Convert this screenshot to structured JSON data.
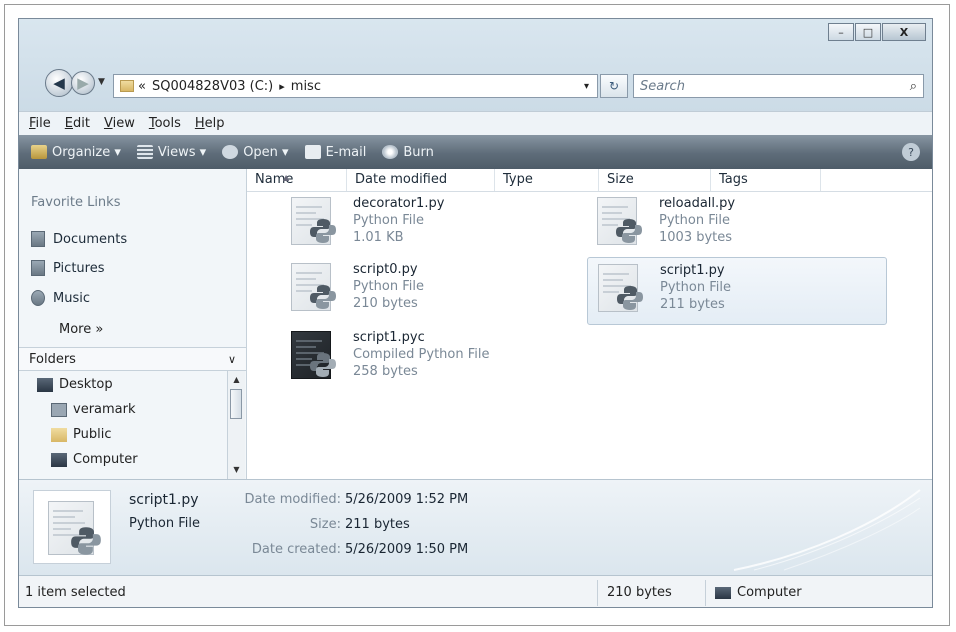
{
  "window": {
    "caption_buttons": {
      "minimize": "–",
      "maximize": "□",
      "close": "X"
    }
  },
  "address_bar": {
    "overflow_chevron": "«",
    "drive": "SQ004828V03 (C:)",
    "separator": "▸",
    "folder": "misc",
    "dropdown": "▾",
    "refresh_glyph": "↻"
  },
  "search": {
    "placeholder": "Search",
    "icon": "⌕"
  },
  "menu": {
    "file_hot": "F",
    "file_rest": "ile",
    "edit_hot": "E",
    "edit_rest": "dit",
    "view_hot": "V",
    "view_rest": "iew",
    "tools_hot": "T",
    "tools_rest": "ools",
    "help_hot": "H",
    "help_rest": "elp"
  },
  "toolbar": {
    "organize": "Organize ▾",
    "views": "Views ▾",
    "open": "Open ▾",
    "email": "E-mail",
    "burn": "Burn",
    "help": "?"
  },
  "nav": {
    "favorite_links_title": "Favorite Links",
    "links": [
      "Documents",
      "Pictures",
      "Music"
    ],
    "more": "More »",
    "folders_title": "Folders",
    "folders_chevron": "∨",
    "tree": [
      "Desktop",
      "veramark",
      "Public",
      "Computer"
    ]
  },
  "columns": {
    "name": "Name",
    "date_modified": "Date modified",
    "type": "Type",
    "size": "Size",
    "tags": "Tags"
  },
  "files": [
    {
      "name": "decorator1.py",
      "type": "Python File",
      "size": "1.01 KB"
    },
    {
      "name": "reloadall.py",
      "type": "Python File",
      "size": "1003 bytes"
    },
    {
      "name": "script0.py",
      "type": "Python File",
      "size": "210 bytes"
    },
    {
      "name": "script1.py",
      "type": "Python File",
      "size": "211 bytes"
    },
    {
      "name": "script1.pyc",
      "type": "Compiled Python File",
      "size": "258 bytes"
    }
  ],
  "details": {
    "name": "script1.py",
    "type": "Python File",
    "date_modified_label": "Date modified:",
    "date_modified": "5/26/2009 1:52 PM",
    "size_label": "Size:",
    "size": "211 bytes",
    "date_created_label": "Date created:",
    "date_created": "5/26/2009 1:50 PM"
  },
  "status": {
    "selection": "1 item selected",
    "size": "210 bytes",
    "location": "Computer"
  },
  "icons": {
    "back": "arrow-left-icon",
    "forward": "arrow-right-icon",
    "python_file": "python-file-icon",
    "computer": "computer-icon"
  },
  "colors": {
    "toolbar": "#5e6c79",
    "selection": "#e4edf5",
    "window_frame": "#c8d8e4"
  }
}
